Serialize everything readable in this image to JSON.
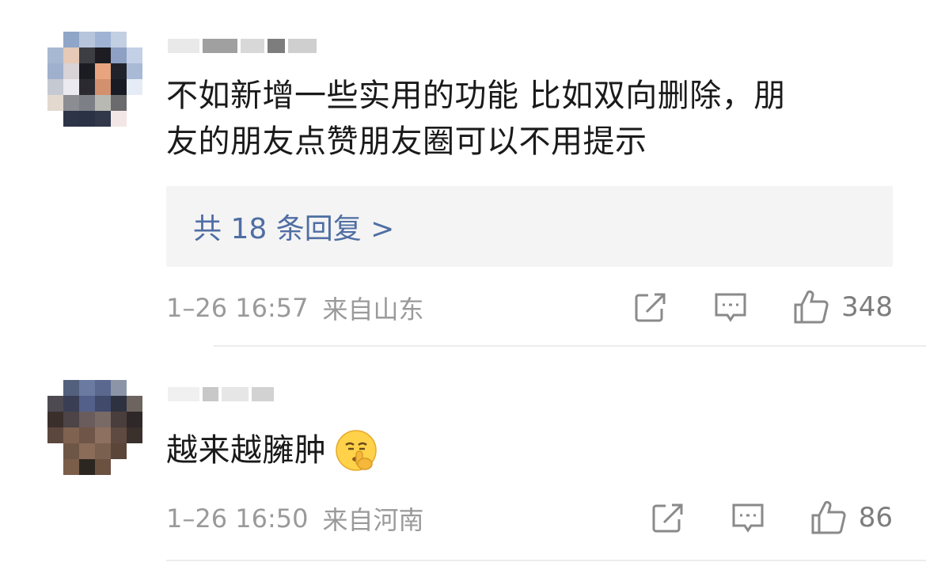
{
  "comments": [
    {
      "text_line1": "不如新增一些实用的功能 比如双向删除，朋",
      "text_line2": "友的朋友点赞朋友圈可以不用提示",
      "replies_label": "共 18 条回复 >",
      "time": "1–26 16:57",
      "location": "来自山东",
      "likes": "348"
    },
    {
      "text": "越来越臃肿",
      "emoji": "shushing-face-emoji",
      "time": "1–26 16:50",
      "location": "来自河南",
      "likes": "86"
    }
  ],
  "icons": {
    "share": "share-edit-icon",
    "comment": "comment-bubble-icon",
    "like": "thumbs-up-icon"
  }
}
